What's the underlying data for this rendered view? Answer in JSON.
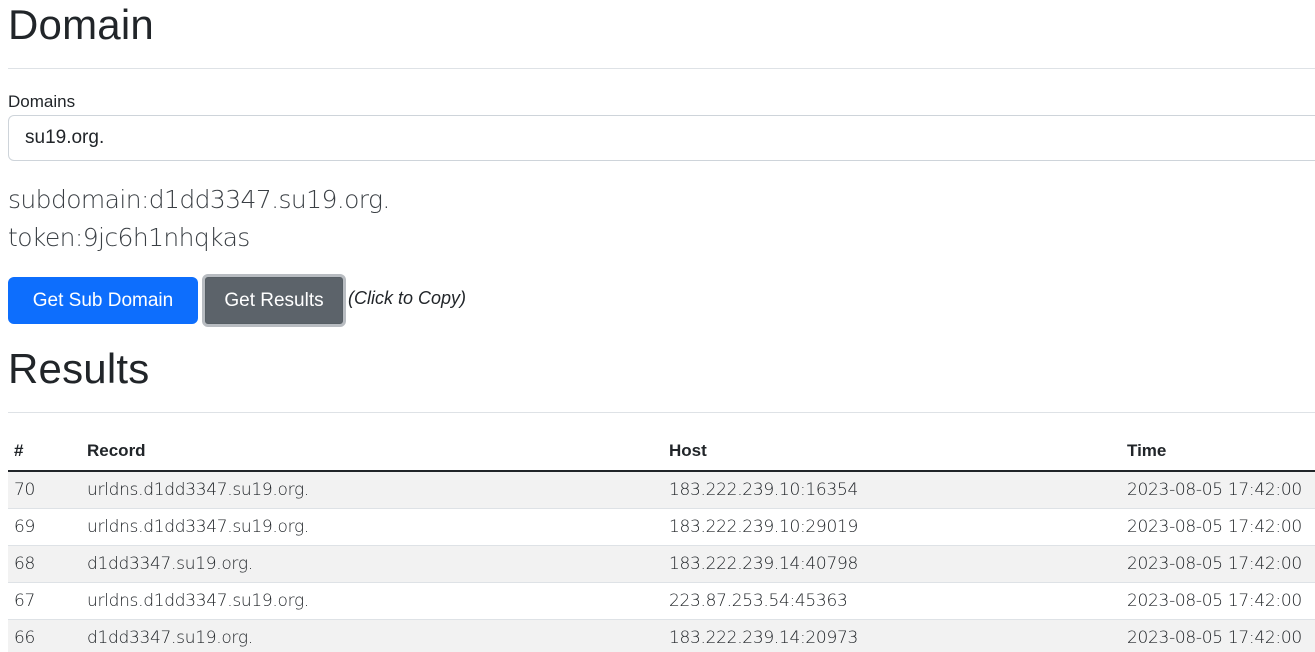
{
  "domain_section": {
    "title": "Domain",
    "field_label": "Domains",
    "input_value": "su19.org.",
    "subdomain_line": "subdomain:d1dd3347.su19.org.",
    "token_line": "token:9jc6h1nhqkas",
    "buttons": {
      "get_sub_domain": "Get Sub Domain",
      "get_results": "Get Results"
    },
    "copy_note": "(Click to Copy)"
  },
  "results_section": {
    "title": "Results",
    "columns": [
      "#",
      "Record",
      "Host",
      "Time"
    ],
    "rows": [
      {
        "num": "70",
        "record": "urldns.d1dd3347.su19.org.",
        "host": "183.222.239.10:16354",
        "time": "2023-08-05 17:42:00"
      },
      {
        "num": "69",
        "record": "urldns.d1dd3347.su19.org.",
        "host": "183.222.239.10:29019",
        "time": "2023-08-05 17:42:00"
      },
      {
        "num": "68",
        "record": "d1dd3347.su19.org.",
        "host": "183.222.239.14:40798",
        "time": "2023-08-05 17:42:00"
      },
      {
        "num": "67",
        "record": "urldns.d1dd3347.su19.org.",
        "host": "223.87.253.54:45363",
        "time": "2023-08-05 17:42:00"
      },
      {
        "num": "66",
        "record": "d1dd3347.su19.org.",
        "host": "183.222.239.14:20973",
        "time": "2023-08-05 17:42:00"
      }
    ]
  },
  "colors": {
    "primary": "#0d6efd",
    "secondary": "#5c636a"
  }
}
